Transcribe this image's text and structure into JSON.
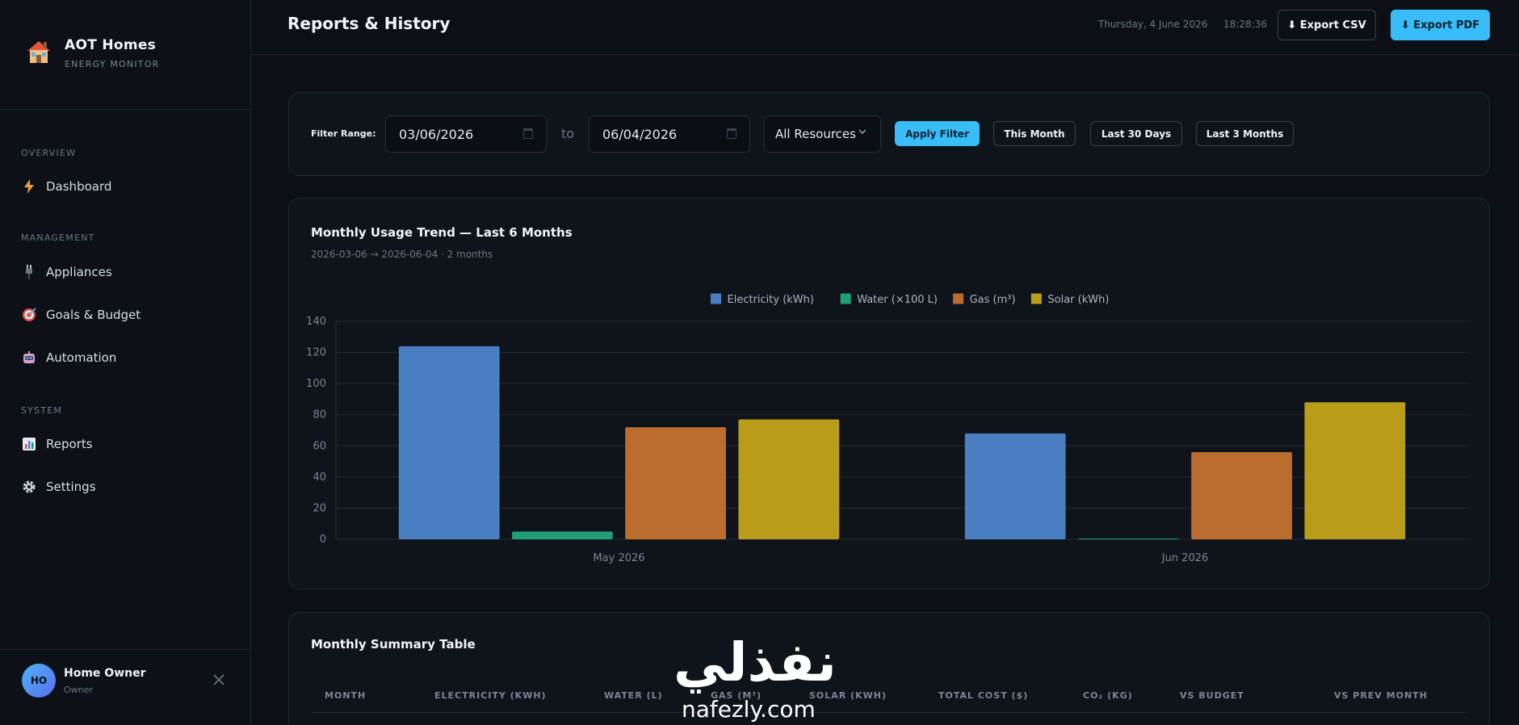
{
  "brand": {
    "name": "AOT Homes",
    "subtitle": "ENERGY MONITOR"
  },
  "sidebar": {
    "sections": [
      {
        "label": "OVERVIEW"
      },
      {
        "label": "MANAGEMENT"
      },
      {
        "label": "SYSTEM"
      }
    ],
    "items": [
      {
        "label": "Dashboard",
        "icon": "lightning-icon"
      },
      {
        "label": "Appliances",
        "icon": "plug-icon"
      },
      {
        "label": "Goals & Budget",
        "icon": "target-icon"
      },
      {
        "label": "Automation",
        "icon": "robot-icon"
      },
      {
        "label": "Reports",
        "icon": "bar-chart-icon"
      },
      {
        "label": "Settings",
        "icon": "gear-icon"
      }
    ]
  },
  "user": {
    "initials": "HO",
    "name": "Home Owner",
    "role": "Owner"
  },
  "header": {
    "title": "Reports & History",
    "date": "Thursday, 4 June 2026",
    "time": "18:28:36",
    "export_csv": "⬇ Export CSV",
    "export_pdf": "⬇ Export PDF"
  },
  "filter": {
    "label": "Filter Range:",
    "start_date": "03/06/2026",
    "to": "to",
    "end_date": "06/04/2026",
    "resource": "All Resources",
    "apply": "Apply Filter",
    "quick": [
      "This Month",
      "Last 30 Days",
      "Last 3 Months"
    ]
  },
  "chart_card": {
    "title": "Monthly Usage Trend — Last 6 Months",
    "subtitle": "2026-03-06 → 2026-06-04 · 2 months"
  },
  "chart_data": {
    "type": "bar",
    "categories": [
      "May 2026",
      "Jun 2026"
    ],
    "series": [
      {
        "name": "Electricity (kWh)",
        "values": [
          124,
          68
        ],
        "color": "#4a7fc1"
      },
      {
        "name": "Water (×100 L)",
        "values": [
          5,
          0.5
        ],
        "color": "#1f9e78"
      },
      {
        "name": "Gas (m³)",
        "values": [
          72,
          56
        ],
        "color": "#bb6d30"
      },
      {
        "name": "Solar (kWh)",
        "values": [
          77,
          88
        ],
        "color": "#b89c1a"
      }
    ],
    "ylim": [
      0,
      140
    ],
    "yticks": [
      0,
      20,
      40,
      60,
      80,
      100,
      120,
      140
    ],
    "grid": true,
    "legend": "top-center"
  },
  "table": {
    "title": "Monthly Summary Table",
    "columns": [
      "MONTH",
      "ELECTRICITY (KWH)",
      "WATER (L)",
      "GAS (M³)",
      "SOLAR (KWH)",
      "TOTAL COST ($)",
      "CO₂ (KG)",
      "VS BUDGET",
      "VS PREV MONTH"
    ]
  },
  "watermark": {
    "arabic": "نفذلي",
    "latin": "nafezly.com"
  }
}
